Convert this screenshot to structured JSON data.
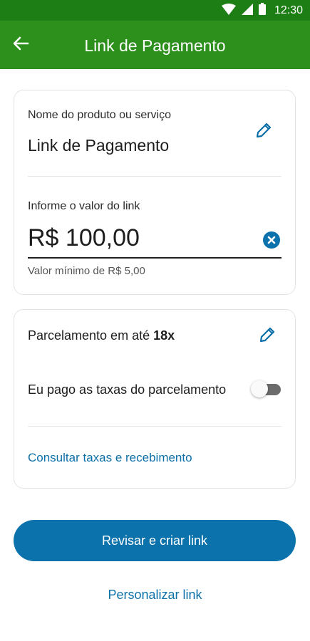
{
  "status_bar": {
    "time": "12:30",
    "icons": [
      "wifi-icon",
      "signal-icon",
      "battery-icon"
    ]
  },
  "app_bar": {
    "title": "Link de Pagamento",
    "back_icon": "arrow-left-icon"
  },
  "product_card": {
    "product_label": "Nome do produto ou serviço",
    "product_name": "Link de Pagamento",
    "amount_label": "Informe o valor do link",
    "amount_value": "R$ 100,00",
    "min_value_helper": "Valor mínimo de R$ 5,00"
  },
  "installment_card": {
    "installment_prefix": "Parcelamento em até ",
    "installment_count": "18x",
    "fee_toggle_label": "Eu pago as taxas do parcelamento",
    "fee_toggle_on": false,
    "consult_link": "Consultar taxas e recebimento"
  },
  "actions": {
    "primary_button": "Revisar e criar link",
    "secondary_link": "Personalizar link"
  },
  "colors": {
    "status_bar": "#1e7e16",
    "app_bar": "#2d8f1c",
    "primary": "#0b72ac",
    "link": "#0b6fa8"
  }
}
